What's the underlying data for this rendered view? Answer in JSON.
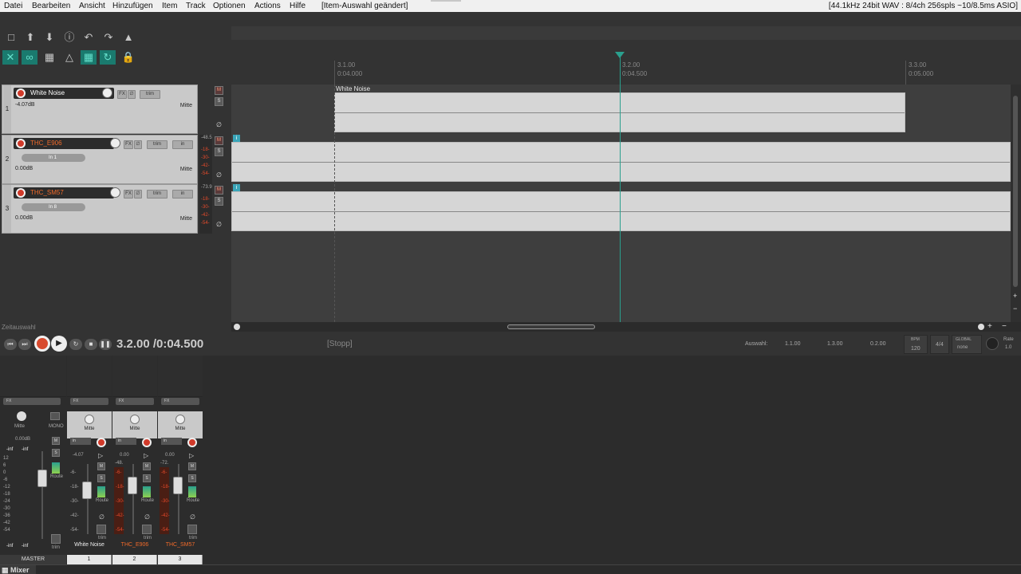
{
  "menu": {
    "items": [
      "Datei",
      "Bearbeiten",
      "Ansicht",
      "Hinzufügen",
      "Item",
      "Track",
      "Optionen",
      "Actions",
      "Hilfe"
    ],
    "status": "[Item-Auswahl geändert]",
    "audio_info": "[44.1kHz 24bit WAV : 8/4ch 256spls ~10/8.5ms ASIO]"
  },
  "toolbar": {
    "icons": [
      "new-project-icon",
      "upload-icon",
      "download-icon",
      "info-icon",
      "undo-icon",
      "redo-icon",
      "metronome-icon",
      "ripple-icon",
      "link-icon",
      "snap-icon",
      "group-icon",
      "grid-icon",
      "loop-icon",
      "lock-icon"
    ],
    "accent": "#1a7a6e"
  },
  "ruler": {
    "marks": [
      {
        "bar": "3.1.00",
        "time": "0:04.000"
      },
      {
        "bar": "3.2.00",
        "time": "0:04.500"
      },
      {
        "bar": "3.3.00",
        "time": "0:05.000"
      }
    ]
  },
  "tracks": [
    {
      "num": "1",
      "name": "White Noise",
      "vol": "-4.07dB",
      "pan": "Mitte",
      "input": "",
      "meter": "",
      "color": "#ffffff"
    },
    {
      "num": "2",
      "name": "THC_E906",
      "vol": "0.00dB",
      "pan": "Mitte",
      "input": "In 1",
      "meter": "-48.5",
      "color": "#f06a2a"
    },
    {
      "num": "3",
      "name": "THC_SM57",
      "vol": "0.00dB",
      "pan": "Mitte",
      "input": "In 8",
      "meter": "-73.9",
      "color": "#f06a2a"
    }
  ],
  "track_controls": {
    "fx": "FX",
    "trim": "trim",
    "in": "in",
    "m": "M",
    "s": "S",
    "meter_scale": [
      "-18-",
      "-30-",
      "-42-",
      "-54-"
    ]
  },
  "items": [
    {
      "label": "White Noise"
    }
  ],
  "selection_label": "Zeitauswahl",
  "transport": {
    "time": "3.2.00 /0:04.500",
    "state": "[Stopp]",
    "auswahl_label": "Auswahl:",
    "sel_start": "1.1.00",
    "sel_end": "1.3.00",
    "sel_len": "0.2.00",
    "bpm_label": "BPM",
    "bpm": "120",
    "timesig": "4/4",
    "global": "GLOBAL",
    "none": "none",
    "rate_label": "Rate",
    "rate": "1.0"
  },
  "mixer": {
    "master": {
      "name": "MASTER",
      "pan": "Mitte",
      "mono": "MONO",
      "vol": "0.00dB",
      "peak_l": "-inf",
      "peak_r": "-inf",
      "route": "Route",
      "trim": "trim",
      "fx": "FX"
    },
    "strips": [
      {
        "num": "1",
        "name": "White Noise",
        "pan": "Mitte",
        "in": "in",
        "vol": "-4.07",
        "route": "Route",
        "trim": "trim"
      },
      {
        "num": "2",
        "name": "THC_E906",
        "pan": "Mitte",
        "in": "in",
        "vol": "0.00",
        "peak": "-48.",
        "route": "Route",
        "trim": "trim"
      },
      {
        "num": "3",
        "name": "THC_SM57",
        "pan": "Mitte",
        "in": "in",
        "vol": "0.00",
        "peak": "-72.",
        "route": "Route",
        "trim": "trim"
      }
    ],
    "scale": [
      "-6-",
      "-18-",
      "-30-",
      "-42-",
      "-54-"
    ],
    "master_scale": [
      "12",
      "6",
      "0",
      "-6",
      "-12",
      "-18",
      "-24",
      "-30",
      "-36",
      "-42",
      "-54"
    ],
    "tab_label": "Mixer"
  }
}
